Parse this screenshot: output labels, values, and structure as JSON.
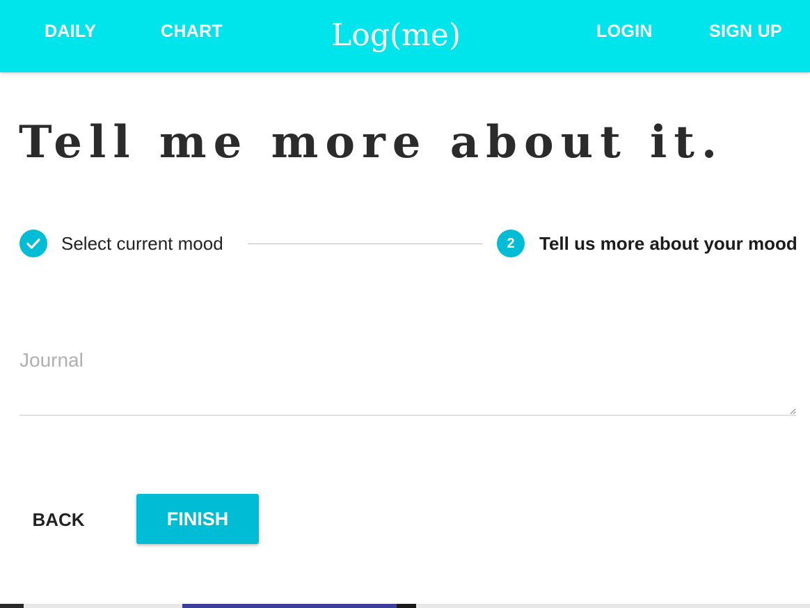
{
  "navbar": {
    "links_left": [
      {
        "label": "DAILY"
      },
      {
        "label": "CHART"
      }
    ],
    "brand": "Log(me)",
    "links_right": [
      {
        "label": "LOGIN"
      },
      {
        "label": "SIGN UP"
      }
    ],
    "color": "#00e5ec"
  },
  "page": {
    "title": "Tell me more about it."
  },
  "stepper": {
    "steps": [
      {
        "label": "Select current mood",
        "state": "completed",
        "icon": "check-icon"
      },
      {
        "label": "Tell us more about your mood",
        "state": "active",
        "number": "2"
      }
    ],
    "accent_color": "#00bcd4"
  },
  "form": {
    "journal": {
      "placeholder": "Journal",
      "value": ""
    }
  },
  "actions": {
    "back_label": "BACK",
    "finish_label": "FINISH"
  }
}
